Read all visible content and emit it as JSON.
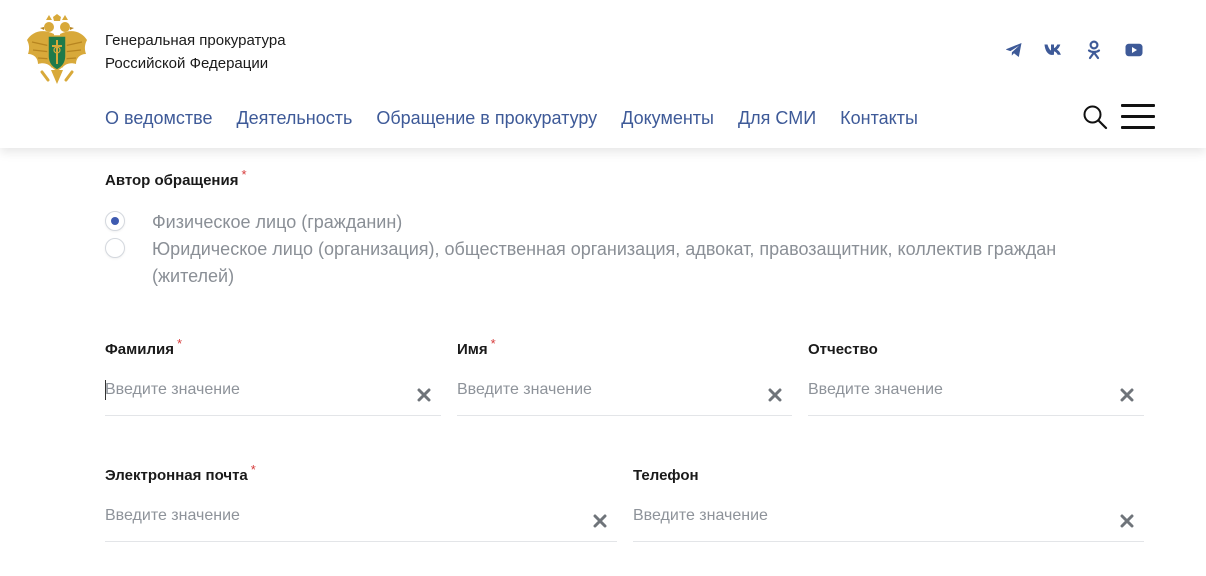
{
  "header": {
    "org_line1": "Генеральная прокуратура",
    "org_line2": "Российской Федерации",
    "nav": [
      {
        "label": "О ведомстве"
      },
      {
        "label": "Деятельность"
      },
      {
        "label": "Обращение в прокуратуру"
      },
      {
        "label": "Документы"
      },
      {
        "label": "Для СМИ"
      },
      {
        "label": "Контакты"
      }
    ],
    "social_icons": [
      "telegram-icon",
      "vk-icon",
      "odnoklassniki-icon",
      "youtube-icon"
    ],
    "colors": {
      "brand": "#3e5a98",
      "emblem_gold": "#d8a93a",
      "emblem_green": "#1f7a4a"
    }
  },
  "form": {
    "author": {
      "label": "Автор обращения",
      "required_mark": "*",
      "options": [
        {
          "label": "Физическое лицо (гражданин)",
          "checked": true
        },
        {
          "label": "Юридическое лицо (организация), общественная организация, адвокат, правозащитник, коллектив граждан (жителей)",
          "checked": false
        }
      ]
    },
    "fields": {
      "surname": {
        "label": "Фамилия",
        "required_mark": "*",
        "placeholder": "Введите значение",
        "value": ""
      },
      "name": {
        "label": "Имя",
        "required_mark": "*",
        "placeholder": "Введите значение",
        "value": ""
      },
      "patronymic": {
        "label": "Отчество",
        "placeholder": "Введите значение",
        "value": ""
      },
      "email": {
        "label": "Электронная почта",
        "required_mark": "*",
        "placeholder": "Введите значение",
        "value": ""
      },
      "phone": {
        "label": "Телефон",
        "placeholder": "Введите значение",
        "value": ""
      }
    },
    "colors": {
      "required": "#d63a3a",
      "radio_selected": "#3e5ab0",
      "placeholder": "#8e939a"
    }
  }
}
